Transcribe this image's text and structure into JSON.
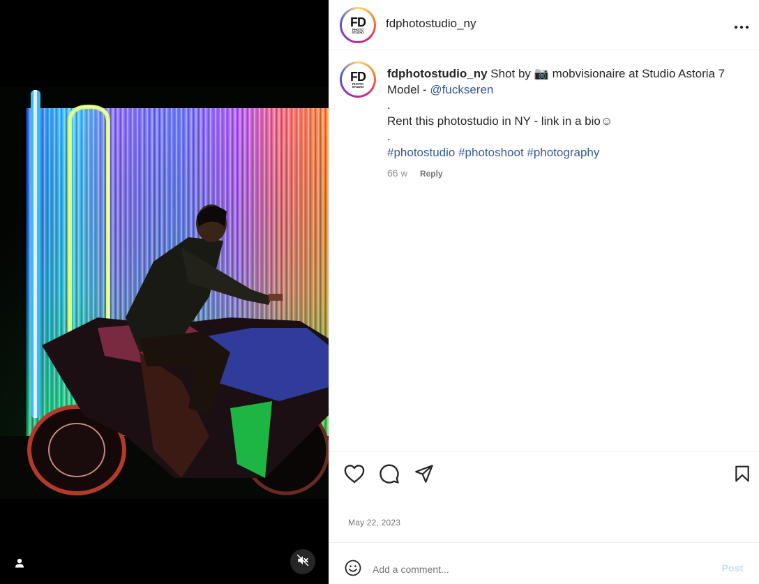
{
  "post": {
    "username": "fdphotostudio_ny",
    "avatar": {
      "main": "FD",
      "sub": "PHOTO STUDIO"
    },
    "caption": {
      "username": "fdphotostudio_ny",
      "line1_prefix": "Shot by",
      "camera_emoji": "📷",
      "line1_suffix": "mobvisionaire at Studio Astoria 7",
      "line2_prefix": "Model - ",
      "model_mention": "@fuckseren",
      "dot1": ".",
      "line3": "Rent this photostudio in NY - link in a bio☺",
      "dot2": ".",
      "hashtags": "#photostudio #photoshoot #photography"
    },
    "age": "66",
    "age_unit": "w",
    "reply_label": "Reply",
    "date": "May 22, 2023"
  },
  "media": {
    "icons": {
      "user_tag": "person-icon",
      "mute": "volume-muted-icon"
    }
  },
  "actions": {
    "icons": [
      "heart-icon",
      "comment-icon",
      "share-icon",
      "bookmark-icon"
    ]
  },
  "comment": {
    "placeholder": "Add a comment...",
    "post_label": "Post"
  },
  "colors": {
    "link": "#385898",
    "post_disabled": "#c0dffd",
    "border": "#efefef"
  }
}
